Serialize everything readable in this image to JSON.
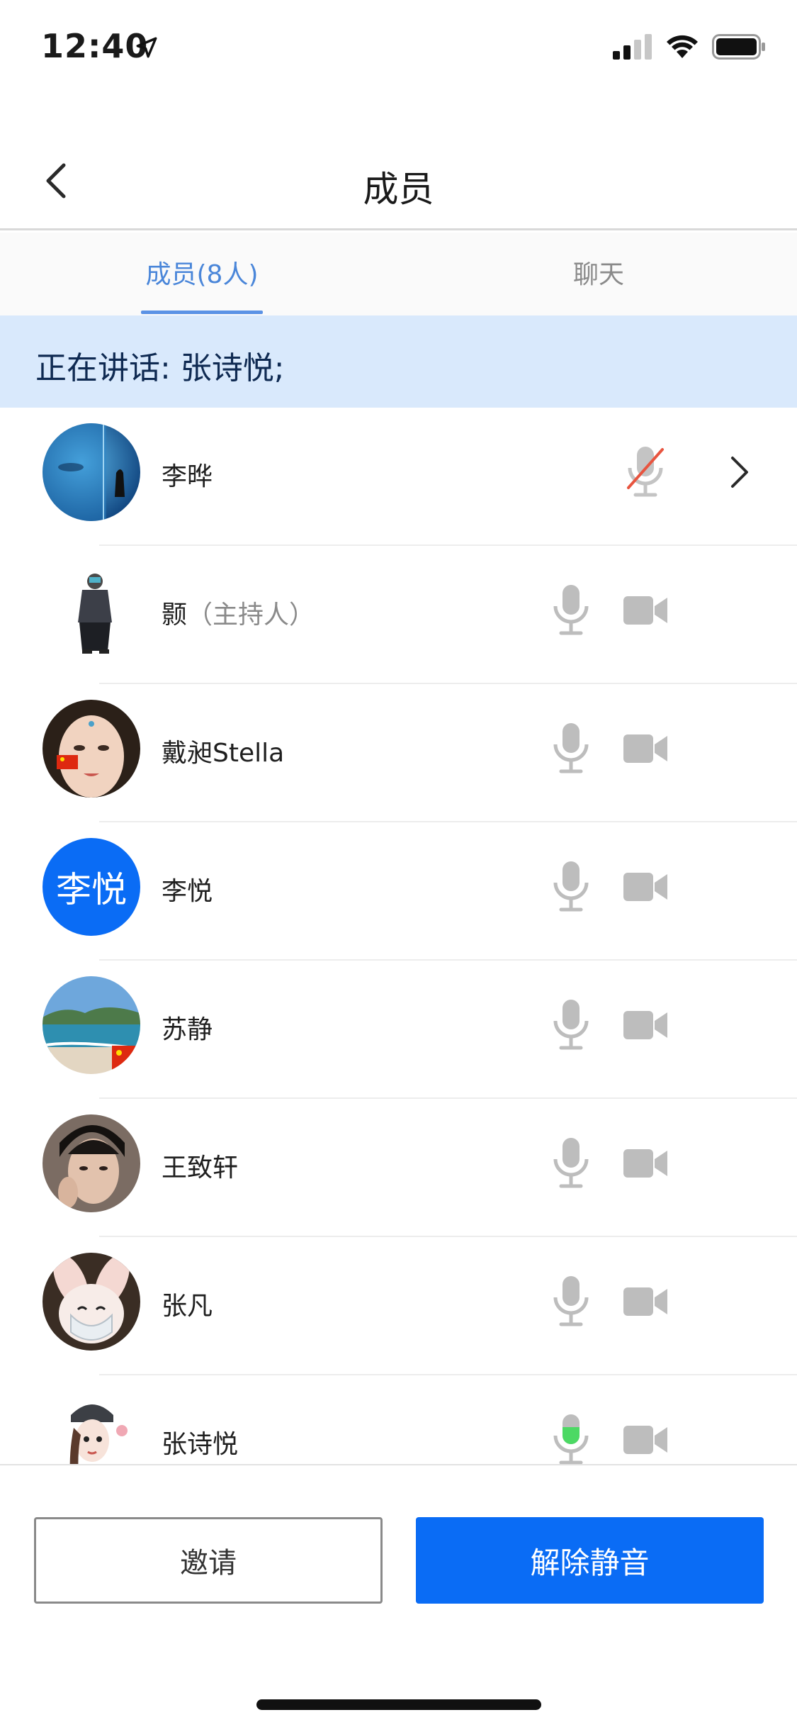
{
  "status": {
    "time": "12:40"
  },
  "header": {
    "title": "成员"
  },
  "tabs": [
    {
      "label": "成员(8人)",
      "active": true
    },
    {
      "label": "聊天",
      "active": false
    }
  ],
  "speaking": {
    "text": "正在讲话: 张诗悦;"
  },
  "members": [
    {
      "name": "李晔",
      "role": "",
      "mic": "muted",
      "has_camera": false,
      "has_chevron": true,
      "avatar": "aquarium-photo"
    },
    {
      "name": "颢",
      "role": "（主持人）",
      "mic": "off",
      "has_camera": true,
      "avatar": "cartoon-figure"
    },
    {
      "name": "戴昶Stella",
      "role": "",
      "mic": "off",
      "has_camera": true,
      "avatar": "portrait-flag"
    },
    {
      "name": "李悦",
      "role": "",
      "mic": "off",
      "has_camera": true,
      "avatar_text": "李悦",
      "avatar_color": "#0a6cf5"
    },
    {
      "name": "苏静",
      "role": "",
      "mic": "off",
      "has_camera": true,
      "avatar": "beach-photo"
    },
    {
      "name": "王致轩",
      "role": "",
      "mic": "off",
      "has_camera": true,
      "avatar": "portrait-dark"
    },
    {
      "name": "张凡",
      "role": "",
      "mic": "off",
      "has_camera": true,
      "avatar": "bunny-mask"
    },
    {
      "name": "张诗悦",
      "role": "",
      "mic": "speaking",
      "has_camera": true,
      "avatar": "cartoon-girl"
    }
  ],
  "buttons": {
    "invite": "邀请",
    "unmute": "解除静音"
  },
  "colors": {
    "accent": "#0a6cf5",
    "tab_active": "#4a86d9",
    "banner_bg": "#d9e9fc",
    "speaking_green": "#4cd964",
    "muted_red": "#e8543f"
  }
}
